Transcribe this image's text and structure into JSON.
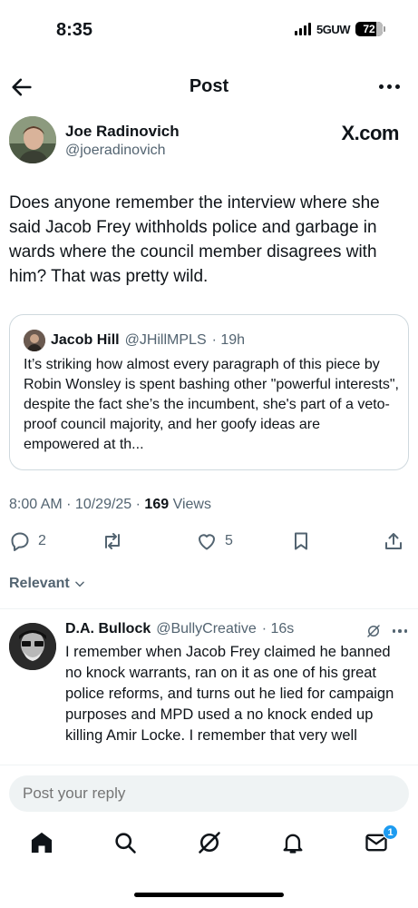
{
  "status_bar": {
    "time": "8:35",
    "network": "5GUW",
    "battery": "72"
  },
  "header": {
    "title": "Post"
  },
  "post": {
    "author_name": "Joe Radinovich",
    "author_handle": "@joeradinovich",
    "source": "X.com",
    "text": "Does anyone remember the interview where she said Jacob Frey withholds police and garbage in wards where the council member disagrees with him? That was pretty wild.",
    "timestamp": "8:00 AM · 10/29/25 · ",
    "views_count": "169",
    "views_label": " Views"
  },
  "quote": {
    "name": "Jacob Hill",
    "handle": "@JHillMPLS",
    "time": "· 19h",
    "text": "It’s striking how almost every paragraph of this piece by Robin Wonsley is spent bashing other \"powerful interests\", despite the fact she’s the incumbent, she's part of a veto-proof council majority, and her goofy ideas are empowered at th..."
  },
  "actions": {
    "replies": "2",
    "likes": "5"
  },
  "sort": {
    "label": "Relevant"
  },
  "reply": {
    "name": "D.A. Bullock",
    "handle": "@BullyCreative",
    "time": "· 16s",
    "text": "I remember when Jacob Frey claimed he banned no knock warrants, ran on it as one of his great police reforms, and turns out he lied for campaign purposes and MPD used a no knock ended up killing Amir Locke. I remember that very well"
  },
  "composer": {
    "placeholder": "Post your reply"
  },
  "tabbar": {
    "messages_badge": "1"
  },
  "colors": {
    "accent": "#1d9bf0",
    "secondary_text": "#536471",
    "primary_text": "#0f1419"
  },
  "icons": [
    "back-arrow-icon",
    "more-icon",
    "reply-icon",
    "repost-icon",
    "like-icon",
    "bookmark-icon",
    "share-icon",
    "chevron-down-icon",
    "grok-icon",
    "home-icon",
    "search-icon",
    "bell-icon",
    "mail-icon"
  ]
}
